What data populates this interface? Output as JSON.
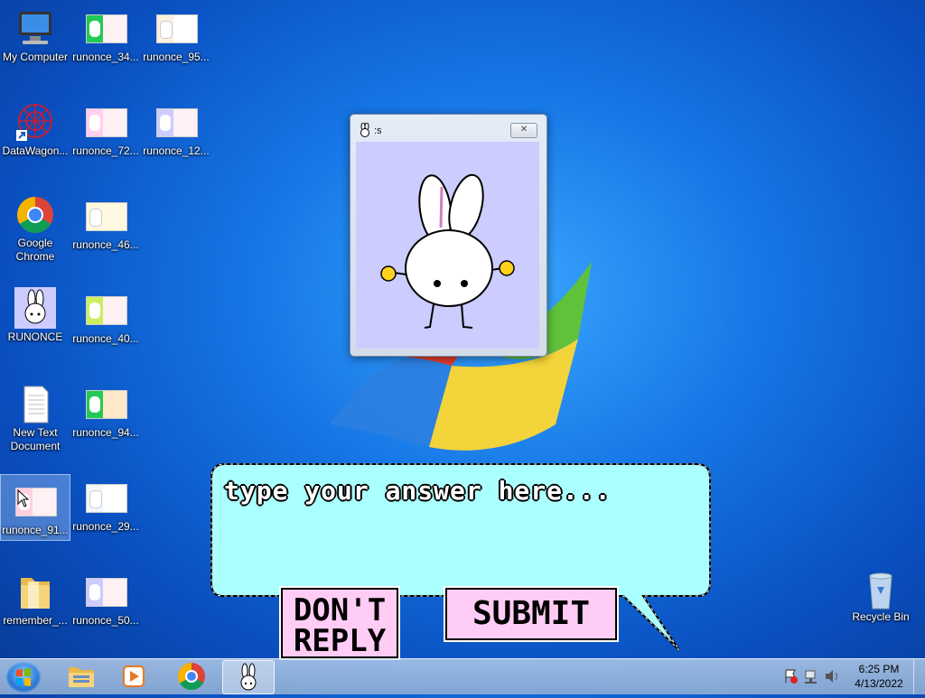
{
  "desktop": {
    "icons": [
      {
        "label": "My Computer"
      },
      {
        "label": "runonce_34..."
      },
      {
        "label": "runonce_95..."
      },
      {
        "label": "DataWagon..."
      },
      {
        "label": "runonce_72..."
      },
      {
        "label": "runonce_12..."
      },
      {
        "label": "Google Chrome"
      },
      {
        "label": "runonce_46..."
      },
      {
        "label": "RUNONCE"
      },
      {
        "label": "runonce_40..."
      },
      {
        "label": "New Text Document"
      },
      {
        "label": "runonce_94..."
      },
      {
        "label": "runonce_91..."
      },
      {
        "label": "runonce_29..."
      },
      {
        "label": "remember_..."
      },
      {
        "label": "runonce_50..."
      },
      {
        "label": "Recycle Bin"
      }
    ]
  },
  "popup": {
    "title": ":s",
    "close_glyph": "✕"
  },
  "dialog": {
    "prompt": "type your answer here...",
    "dont_reply_line1": "DON'T",
    "dont_reply_line2": "REPLY",
    "submit_label": "SUBMIT"
  },
  "taskbar": {
    "time": "6:25 PM",
    "date": "4/13/2022"
  },
  "colors": {
    "bubble": "#aaffff",
    "button": "#ffccf5",
    "popup_body": "#ccccff"
  }
}
